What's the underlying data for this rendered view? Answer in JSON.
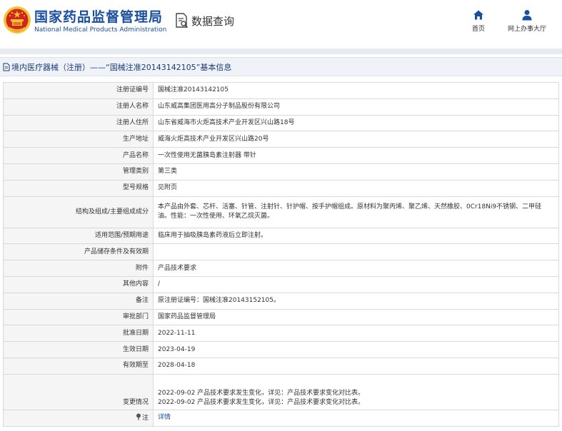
{
  "header": {
    "site_title": "国家药品监督管理局",
    "site_subtitle": "National Medical Products Administration",
    "db_query_label": "数据查询",
    "nav": {
      "home_label": "首页",
      "office_label": "网上办事大厅"
    }
  },
  "breadcrumb": {
    "text": "境内医疗器械（注册）——“国械注准20143142105”基本信息"
  },
  "details": {
    "rows": [
      {
        "label": "注册证编号",
        "value": "国械注准20143142105"
      },
      {
        "label": "注册人名称",
        "value": "山东威高集团医用高分子制品股份有限公司"
      },
      {
        "label": "注册人住所",
        "value": "山东省威海市火炬高技术产业开发区兴山路18号"
      },
      {
        "label": "生产地址",
        "value": "威海火炬高技术产业开发区兴山路20号"
      },
      {
        "label": "产品名称",
        "value": "一次性使用无菌胰岛素注射器 带针"
      },
      {
        "label": "管理类别",
        "value": "第三类"
      },
      {
        "label": "型号规格",
        "value": "见附页"
      },
      {
        "label": "结构及组成/主要组成成分",
        "value": "本产品由外套、芯杆、活塞、针管、注射针、针护帽、按手护帽组成。原材料为聚丙烯、聚乙烯、天然橡胶、0Cr18Ni9不锈钢、二甲硅油。性能：一次性使用、环氧乙烷灭菌。"
      },
      {
        "label": "适用范围/预期用途",
        "value": "临床用于抽吸胰岛素药液后立即注射。"
      },
      {
        "label": "产品储存条件及有效期",
        "value": ""
      },
      {
        "label": "附件",
        "value": "产品技术要求"
      },
      {
        "label": "其他内容",
        "value": "/"
      },
      {
        "label": "备注",
        "value": "原注册证编号：国械注准20143152105。"
      },
      {
        "label": "审批部门",
        "value": "国家药品监督管理局"
      },
      {
        "label": "批准日期",
        "value": "2022-11-11"
      },
      {
        "label": "生效日期",
        "value": "2023-04-19"
      },
      {
        "label": "有效期至",
        "value": "2028-04-18"
      }
    ],
    "change": {
      "label": "变更情况",
      "lines": [
        "2022-09-02 产品技术要求发生变化，详见：产品技术要求变化对比表。",
        "2022-09-02 产品技术要求发生变化，详见：产品技术要求变化对比表。"
      ]
    },
    "note": {
      "label": "注",
      "link": "详情"
    }
  },
  "colors": {
    "brand_blue": "#1a4fa0",
    "logo_red": "#d2261c",
    "logo_gold": "#f3c234"
  }
}
